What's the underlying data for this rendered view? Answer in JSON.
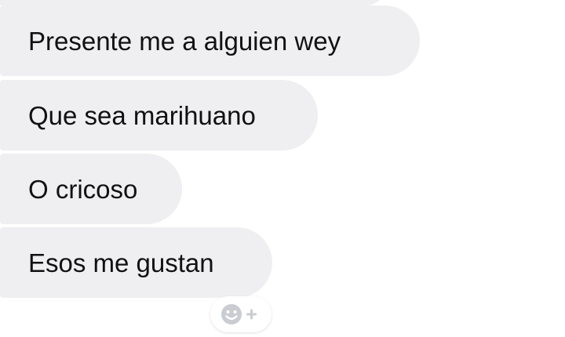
{
  "messages": [
    {
      "text": "Presente me a alguien wey"
    },
    {
      "text": "Que sea marihuano"
    },
    {
      "text": "O cricoso"
    },
    {
      "text": "Esos me gustan"
    }
  ],
  "reaction": {
    "icon": "smiley-add-icon"
  },
  "colors": {
    "bubble": "#efeff1",
    "text": "#111111",
    "icon": "#c9ccd1",
    "background": "#ffffff"
  }
}
